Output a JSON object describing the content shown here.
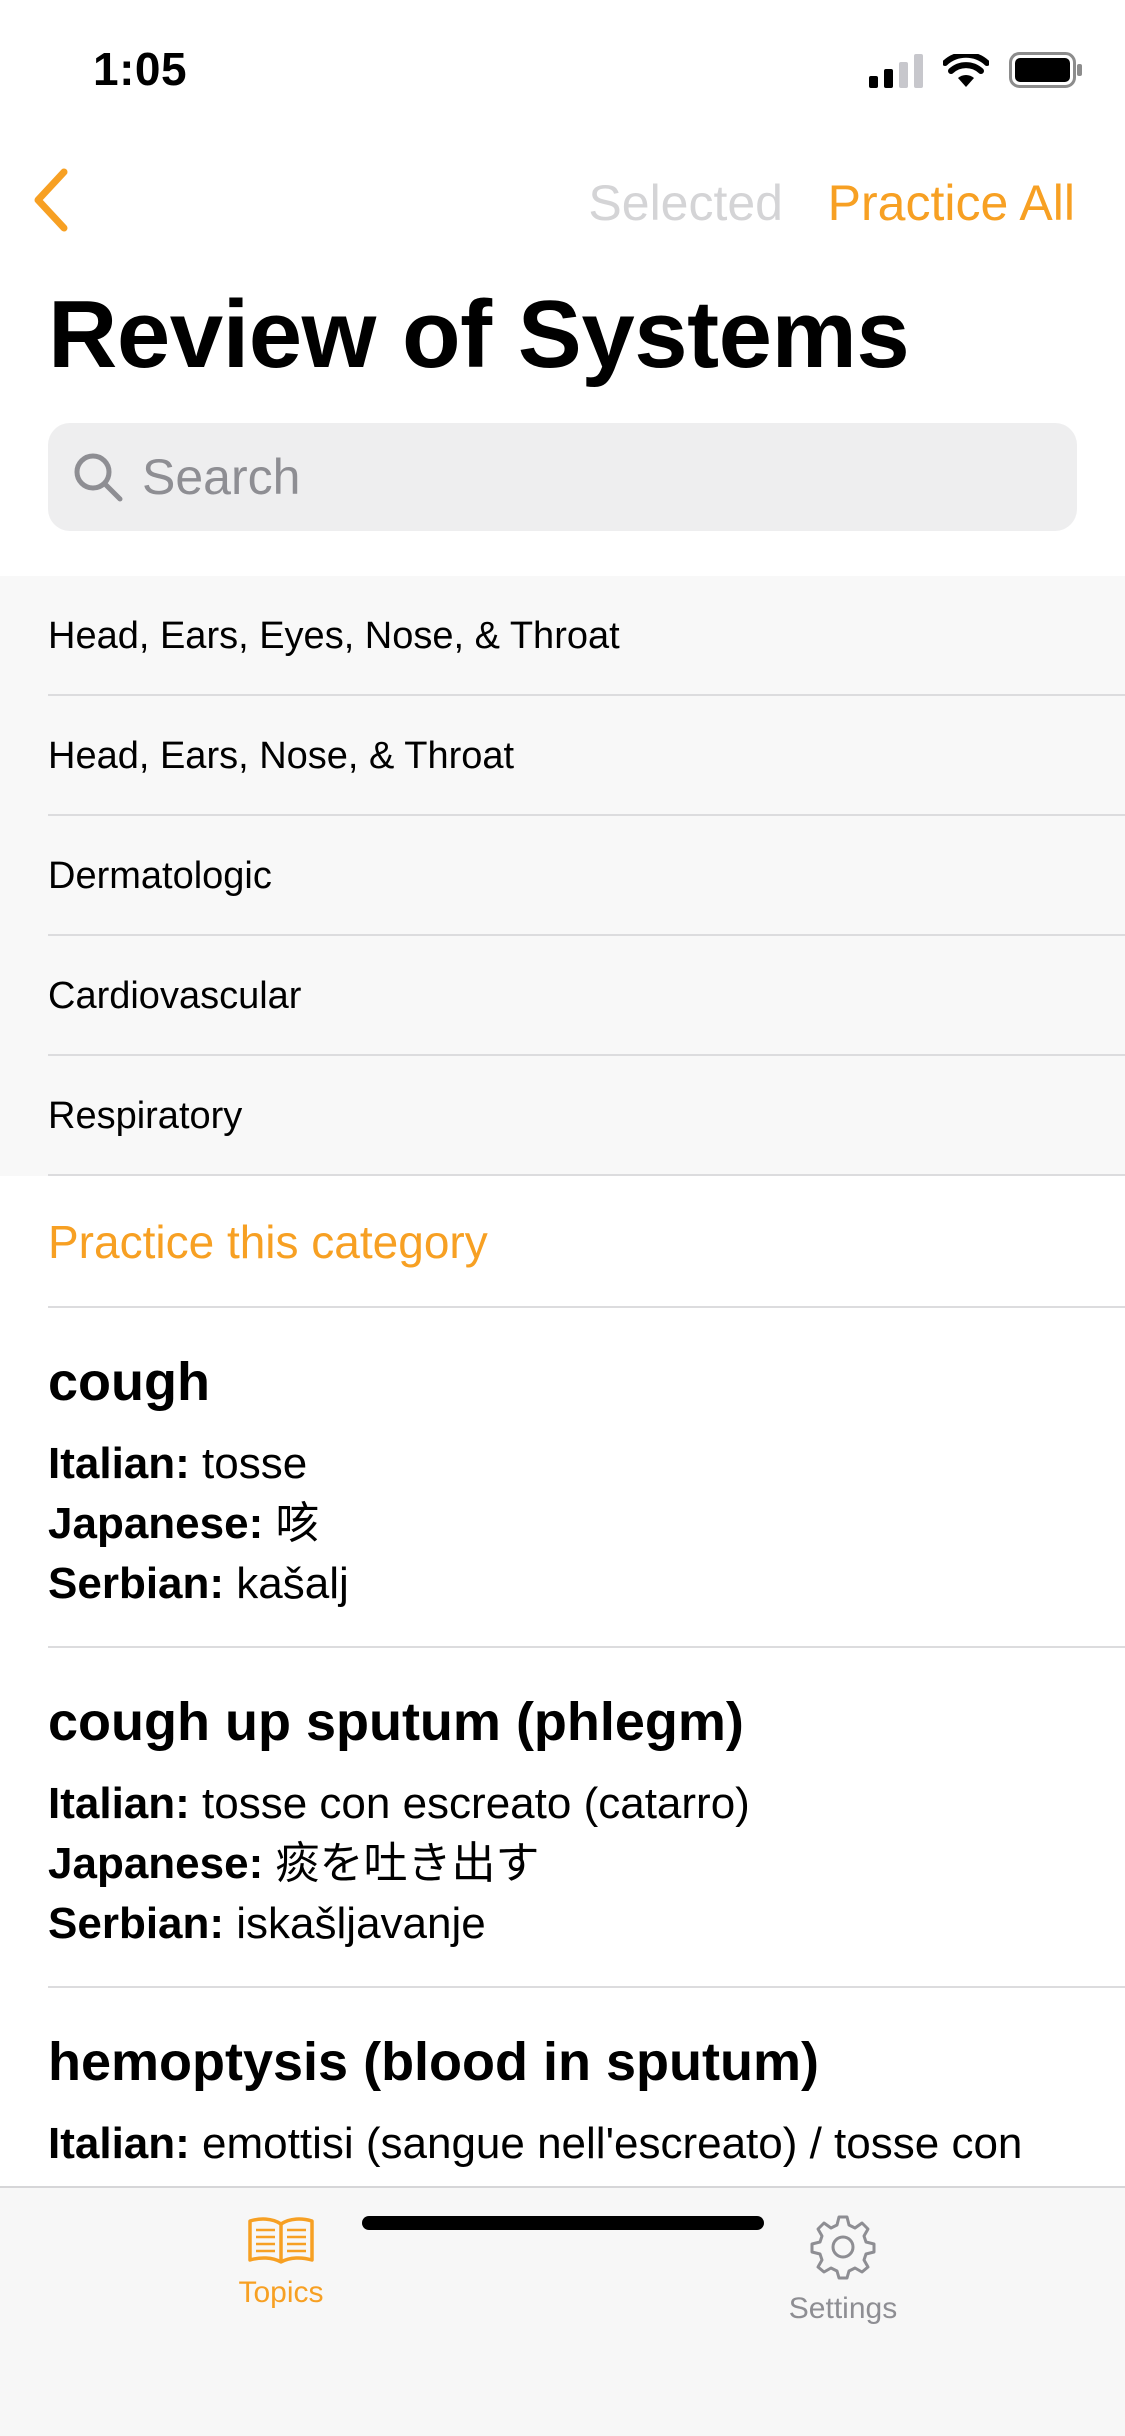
{
  "status_bar": {
    "time": "1:05",
    "signal_icon": "cellular-signal-icon",
    "wifi_icon": "wifi-icon",
    "battery_icon": "battery-icon"
  },
  "nav": {
    "back_icon": "chevron-left-icon",
    "selected_label": "Selected",
    "practice_all_label": "Practice All"
  },
  "page_title": "Review of Systems",
  "search": {
    "placeholder": "Search",
    "icon": "search-icon"
  },
  "categories": [
    "Head, Ears, Eyes, Nose, & Throat",
    "Head, Ears, Nose, & Throat",
    "Dermatologic",
    "Cardiovascular",
    "Respiratory"
  ],
  "practice_category_label": "Practice this category",
  "terms": [
    {
      "title": "cough",
      "lines": [
        {
          "lang": "Italian:",
          "text": "tosse"
        },
        {
          "lang": "Japanese:",
          "text": "咳"
        },
        {
          "lang": "Serbian:",
          "text": "kašalj"
        }
      ]
    },
    {
      "title": "cough up sputum (phlegm)",
      "lines": [
        {
          "lang": "Italian:",
          "text": "tosse con escreato (catarro)"
        },
        {
          "lang": "Japanese:",
          "text": "痰を吐き出す"
        },
        {
          "lang": "Serbian:",
          "text": "iskašljavanje"
        }
      ]
    },
    {
      "title": "hemoptysis (blood in sputum)",
      "lines": [
        {
          "lang": "Italian:",
          "text": "emottisi (sangue nell'escreato) / tosse con sangue"
        }
      ]
    }
  ],
  "tabbar": {
    "topics_label": "Topics",
    "topics_icon": "book-icon",
    "settings_label": "Settings",
    "settings_icon": "gear-icon"
  },
  "colors": {
    "accent": "#f7a023",
    "disabled": "#d4d4d6",
    "separator": "#dcdcde",
    "category_bg": "#f8f8f8"
  }
}
